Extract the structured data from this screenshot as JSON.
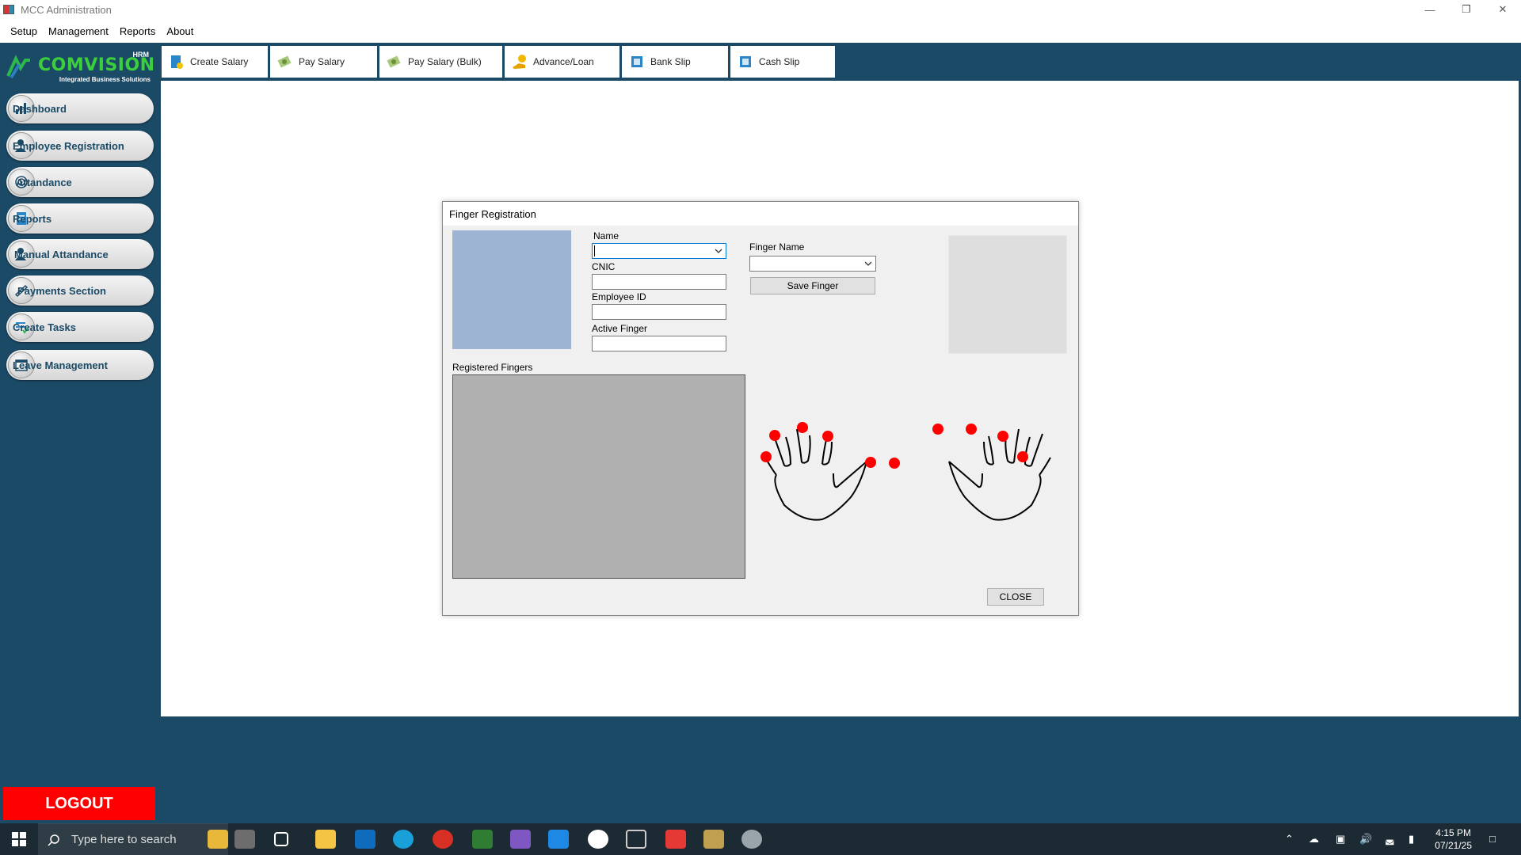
{
  "window": {
    "title": "MCC Administration"
  },
  "menu": [
    "Setup",
    "Management",
    "Reports",
    "About"
  ],
  "logo": {
    "brand": "COMVISION",
    "badge": "HRM",
    "tagline": "Integrated Business Solutions"
  },
  "sidebar": {
    "items": [
      {
        "label": "Dashboard",
        "icon": "chart-icon"
      },
      {
        "label": "Employee Registration",
        "icon": "user-add-icon"
      },
      {
        "label": "Attandance",
        "icon": "fingerprint-icon"
      },
      {
        "label": "Reports",
        "icon": "report-icon"
      },
      {
        "label": "Manual Attandance",
        "icon": "user-edit-icon"
      },
      {
        "label": "Payments Section",
        "icon": "payment-icon"
      },
      {
        "label": "Create Tasks",
        "icon": "tasks-icon"
      },
      {
        "label": "Leave Management",
        "icon": "calendar-icon"
      }
    ],
    "logout": "LOGOUT"
  },
  "toolbar": {
    "buttons": [
      {
        "label": "Create Salary",
        "icon": "document-icon"
      },
      {
        "label": "Pay Salary",
        "icon": "money-icon"
      },
      {
        "label": "Pay Salary (Bulk)",
        "icon": "money-icon"
      },
      {
        "label": "Advance/Loan",
        "icon": "hand-coin-icon"
      },
      {
        "label": "Bank Slip",
        "icon": "slip-icon"
      },
      {
        "label": "Cash Slip",
        "icon": "slip-icon"
      }
    ]
  },
  "dialog": {
    "title": "Finger Registration",
    "name_label": "Name",
    "name_value": "",
    "cnic_label": "CNIC",
    "cnic_value": "",
    "employee_id_label": "Employee ID",
    "employee_id_value": "",
    "active_finger_label": "Active Finger",
    "active_finger_value": "",
    "finger_name_label": "Finger Name",
    "finger_name_value": "",
    "save_finger": "Save Finger",
    "registered_fingers_label": "Registered Fingers",
    "close": "CLOSE",
    "colors": {
      "finger_marker": "#ff0000",
      "photo_bg": "#9db4d3"
    }
  },
  "taskbar": {
    "search_placeholder": "Type here to search",
    "time": "4:15 PM",
    "date": "07/21/25"
  }
}
